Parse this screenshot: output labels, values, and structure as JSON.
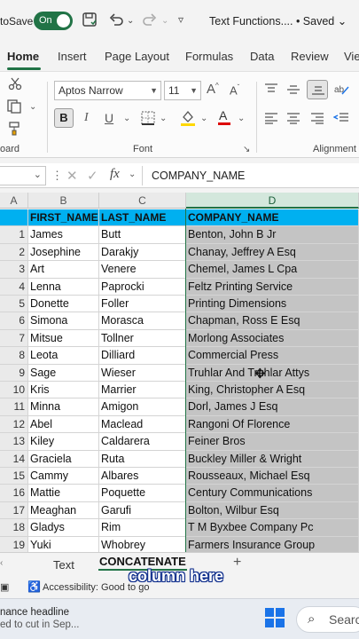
{
  "titlebar": {
    "autosave_label": "toSave",
    "toggle_label": "On",
    "doc_title": "Text Functions.... • Saved ⌄"
  },
  "tabs": [
    "Home",
    "Insert",
    "Page Layout",
    "Formulas",
    "Data",
    "Review",
    "Vie"
  ],
  "ribbon": {
    "font_name": "Aptos Narrow",
    "font_size": "11",
    "font_group_label": "Font",
    "clipboard_group_label": "oard",
    "alignment_group_label": "Alignment",
    "bold": "B",
    "italic": "I",
    "underline": "U"
  },
  "formula_bar": {
    "content": "COMPANY_NAME",
    "fx": "fx"
  },
  "grid": {
    "columns": [
      "A",
      "B",
      "C",
      "D"
    ],
    "headers": [
      "FIRST_NAME",
      "LAST_NAME",
      "COMPANY_NAME"
    ],
    "rows": [
      [
        "1",
        "James",
        "Butt",
        "Benton, John B Jr"
      ],
      [
        "2",
        "Josephine",
        "Darakjy",
        "Chanay, Jeffrey A Esq"
      ],
      [
        "3",
        "Art",
        "Venere",
        "Chemel, James L Cpa"
      ],
      [
        "4",
        "Lenna",
        "Paprocki",
        "Feltz Printing Service"
      ],
      [
        "5",
        "Donette",
        "Foller",
        "Printing Dimensions"
      ],
      [
        "6",
        "Simona",
        "Morasca",
        "Chapman, Ross E Esq"
      ],
      [
        "7",
        "Mitsue",
        "Tollner",
        "Morlong Associates"
      ],
      [
        "8",
        "Leota",
        "Dilliard",
        "Commercial Press"
      ],
      [
        "9",
        "Sage",
        "Wieser",
        "Truhlar And Truhlar Attys"
      ],
      [
        "10",
        "Kris",
        "Marrier",
        "King, Christopher A Esq"
      ],
      [
        "11",
        "Minna",
        "Amigon",
        "Dorl, James J Esq"
      ],
      [
        "12",
        "Abel",
        "Maclead",
        "Rangoni Of Florence"
      ],
      [
        "13",
        "Kiley",
        "Caldarera",
        "Feiner Bros"
      ],
      [
        "14",
        "Graciela",
        "Ruta",
        "Buckley Miller & Wright"
      ],
      [
        "15",
        "Cammy",
        "Albares",
        "Rousseaux, Michael Esq"
      ],
      [
        "16",
        "Mattie",
        "Poquette",
        "Century Communications"
      ],
      [
        "17",
        "Meaghan",
        "Garufi",
        "Bolton, Wilbur Esq"
      ],
      [
        "18",
        "Gladys",
        "Rim",
        "T M Byxbee Company Pc"
      ],
      [
        "19",
        "Yuki",
        "Whobrey",
        "Farmers Insurance Group"
      ]
    ]
  },
  "sheet_tabs": {
    "tab1": "Text",
    "tab2": "CONCATENATE",
    "add": "+"
  },
  "status": {
    "accessibility": "Accessibility: Good to go"
  },
  "caption": "column here",
  "taskbar": {
    "news_line1": "nance headline",
    "news_line2": "ed to cut in Sep...",
    "search": "Searc"
  },
  "colors": {
    "accent": "#217346",
    "header_fill": "#00b0f0",
    "selection": "#c4c4c4"
  }
}
